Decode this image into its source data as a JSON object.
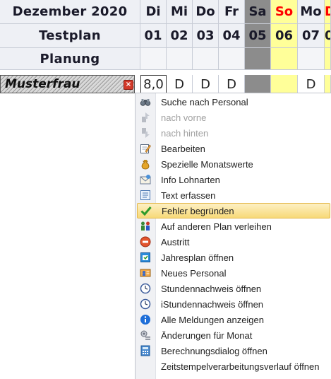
{
  "header": {
    "month_label": "Dezember 2020",
    "plan_label": "Testplan",
    "planning_label": "Planung"
  },
  "days": [
    {
      "name": "Di",
      "num": "01",
      "kind": "weekday",
      "value": "8,0"
    },
    {
      "name": "Mi",
      "num": "02",
      "kind": "weekday",
      "value": "D"
    },
    {
      "name": "Do",
      "num": "03",
      "kind": "weekday",
      "value": "D"
    },
    {
      "name": "Fr",
      "num": "04",
      "kind": "weekday",
      "value": "D"
    },
    {
      "name": "Sa",
      "num": "05",
      "kind": "saturday",
      "value": ""
    },
    {
      "name": "So",
      "num": "06",
      "kind": "sunday",
      "value": ""
    },
    {
      "name": "Mo",
      "num": "07",
      "kind": "weekday",
      "value": "D"
    },
    {
      "name": "D",
      "num": "0",
      "kind": "sunday",
      "value": ""
    }
  ],
  "employee": {
    "name": "Musterfrau",
    "close_glyph": "×"
  },
  "context_menu": {
    "items": [
      {
        "label": "Suche nach Personal",
        "icon": "binoculars-icon",
        "disabled": false,
        "selected": false
      },
      {
        "label": "nach vorne",
        "icon": "move-front-icon",
        "disabled": true,
        "selected": false
      },
      {
        "label": "nach hinten",
        "icon": "move-back-icon",
        "disabled": true,
        "selected": false
      },
      {
        "label": "Bearbeiten",
        "icon": "edit-icon",
        "disabled": false,
        "selected": false
      },
      {
        "label": "Spezielle Monatswerte",
        "icon": "money-bag-icon",
        "disabled": false,
        "selected": false
      },
      {
        "label": "Info Lohnarten",
        "icon": "envelope-icon",
        "disabled": false,
        "selected": false
      },
      {
        "label": "Text erfassen",
        "icon": "text-icon",
        "disabled": false,
        "selected": false
      },
      {
        "label": "Fehler begründen",
        "icon": "checkmark-icon",
        "disabled": false,
        "selected": true
      },
      {
        "label": "Auf anderen Plan verleihen",
        "icon": "lend-icon",
        "disabled": false,
        "selected": false
      },
      {
        "label": "Austritt",
        "icon": "exit-icon",
        "disabled": false,
        "selected": false
      },
      {
        "label": "Jahresplan öffnen",
        "icon": "year-plan-icon",
        "disabled": false,
        "selected": false
      },
      {
        "label": "Neues Personal",
        "icon": "new-person-icon",
        "disabled": false,
        "selected": false
      },
      {
        "label": "Stundennachweis öffnen",
        "icon": "clock-icon",
        "disabled": false,
        "selected": false
      },
      {
        "label": "iStundennachweis öffnen",
        "icon": "clock-i-icon",
        "disabled": false,
        "selected": false
      },
      {
        "label": "Alle Meldungen anzeigen",
        "icon": "info-icon",
        "disabled": false,
        "selected": false
      },
      {
        "label": "Änderungen für Monat",
        "icon": "changes-icon",
        "disabled": false,
        "selected": false
      },
      {
        "label": "Berechnungsdialog öffnen",
        "icon": "calculator-icon",
        "disabled": false,
        "selected": false
      },
      {
        "label": "Zeitstempelverarbeitungsverlauf öffnen",
        "icon": "timestamp-icon",
        "disabled": false,
        "selected": false
      }
    ]
  }
}
